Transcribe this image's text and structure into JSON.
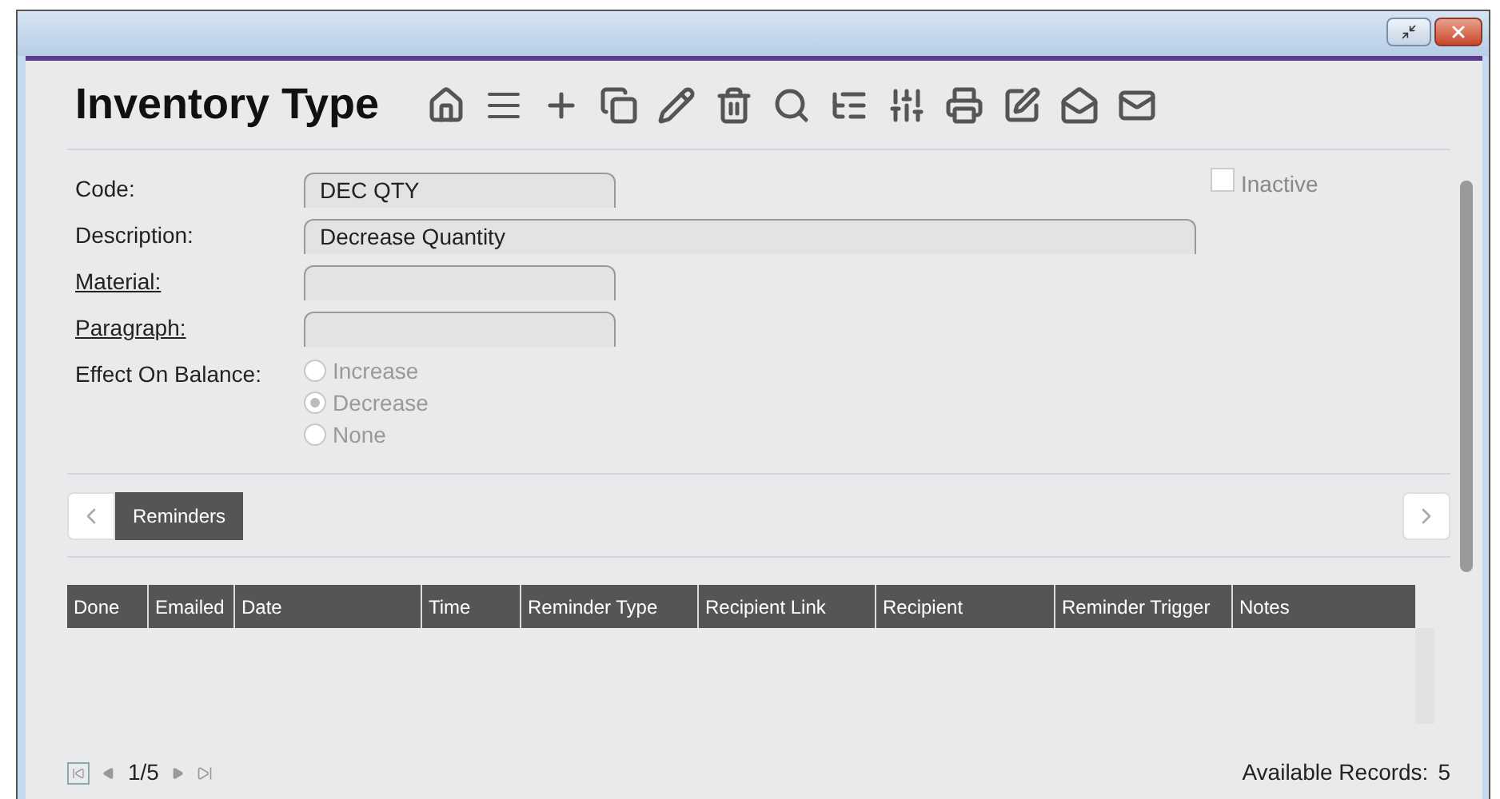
{
  "window": {
    "title": "Inventory Type"
  },
  "toolbar": {
    "tools": [
      {
        "kind": "home"
      },
      {
        "kind": "list"
      },
      {
        "kind": "add"
      },
      {
        "kind": "copy"
      },
      {
        "kind": "edit"
      },
      {
        "kind": "delete"
      },
      {
        "kind": "search"
      },
      {
        "kind": "tree"
      },
      {
        "kind": "columns"
      },
      {
        "kind": "print"
      },
      {
        "kind": "note"
      },
      {
        "kind": "envelope"
      },
      {
        "kind": "mail"
      }
    ]
  },
  "form": {
    "fields": [
      {
        "label": "Code:",
        "link": false,
        "value": "DEC QTY",
        "wide": false
      },
      {
        "label": "Description:",
        "link": false,
        "value": "Decrease Quantity",
        "wide": true
      },
      {
        "label": "Material:",
        "link": true,
        "wide": false
      },
      {
        "label": "Paragraph:",
        "link": true,
        "wide": false
      }
    ],
    "inactive": {
      "label": "Inactive",
      "checked": false
    },
    "effect": {
      "label": "Effect On Balance:",
      "disabled": true,
      "options": [
        {
          "label": "Increase",
          "selected": false
        },
        {
          "label": "Decrease",
          "selected": true
        },
        {
          "label": "None",
          "selected": false
        }
      ]
    }
  },
  "tabs": [
    {
      "label": "Reminders",
      "selected": true
    }
  ],
  "table": {
    "columns": [
      "Done",
      "Emailed",
      "Date",
      "Time",
      "Reminder Type",
      "Recipient Link",
      "Recipient",
      "Reminder Trigger",
      "Notes"
    ]
  },
  "pager": {
    "page": "1/5",
    "records_label": "Available Records:",
    "records": "5"
  }
}
